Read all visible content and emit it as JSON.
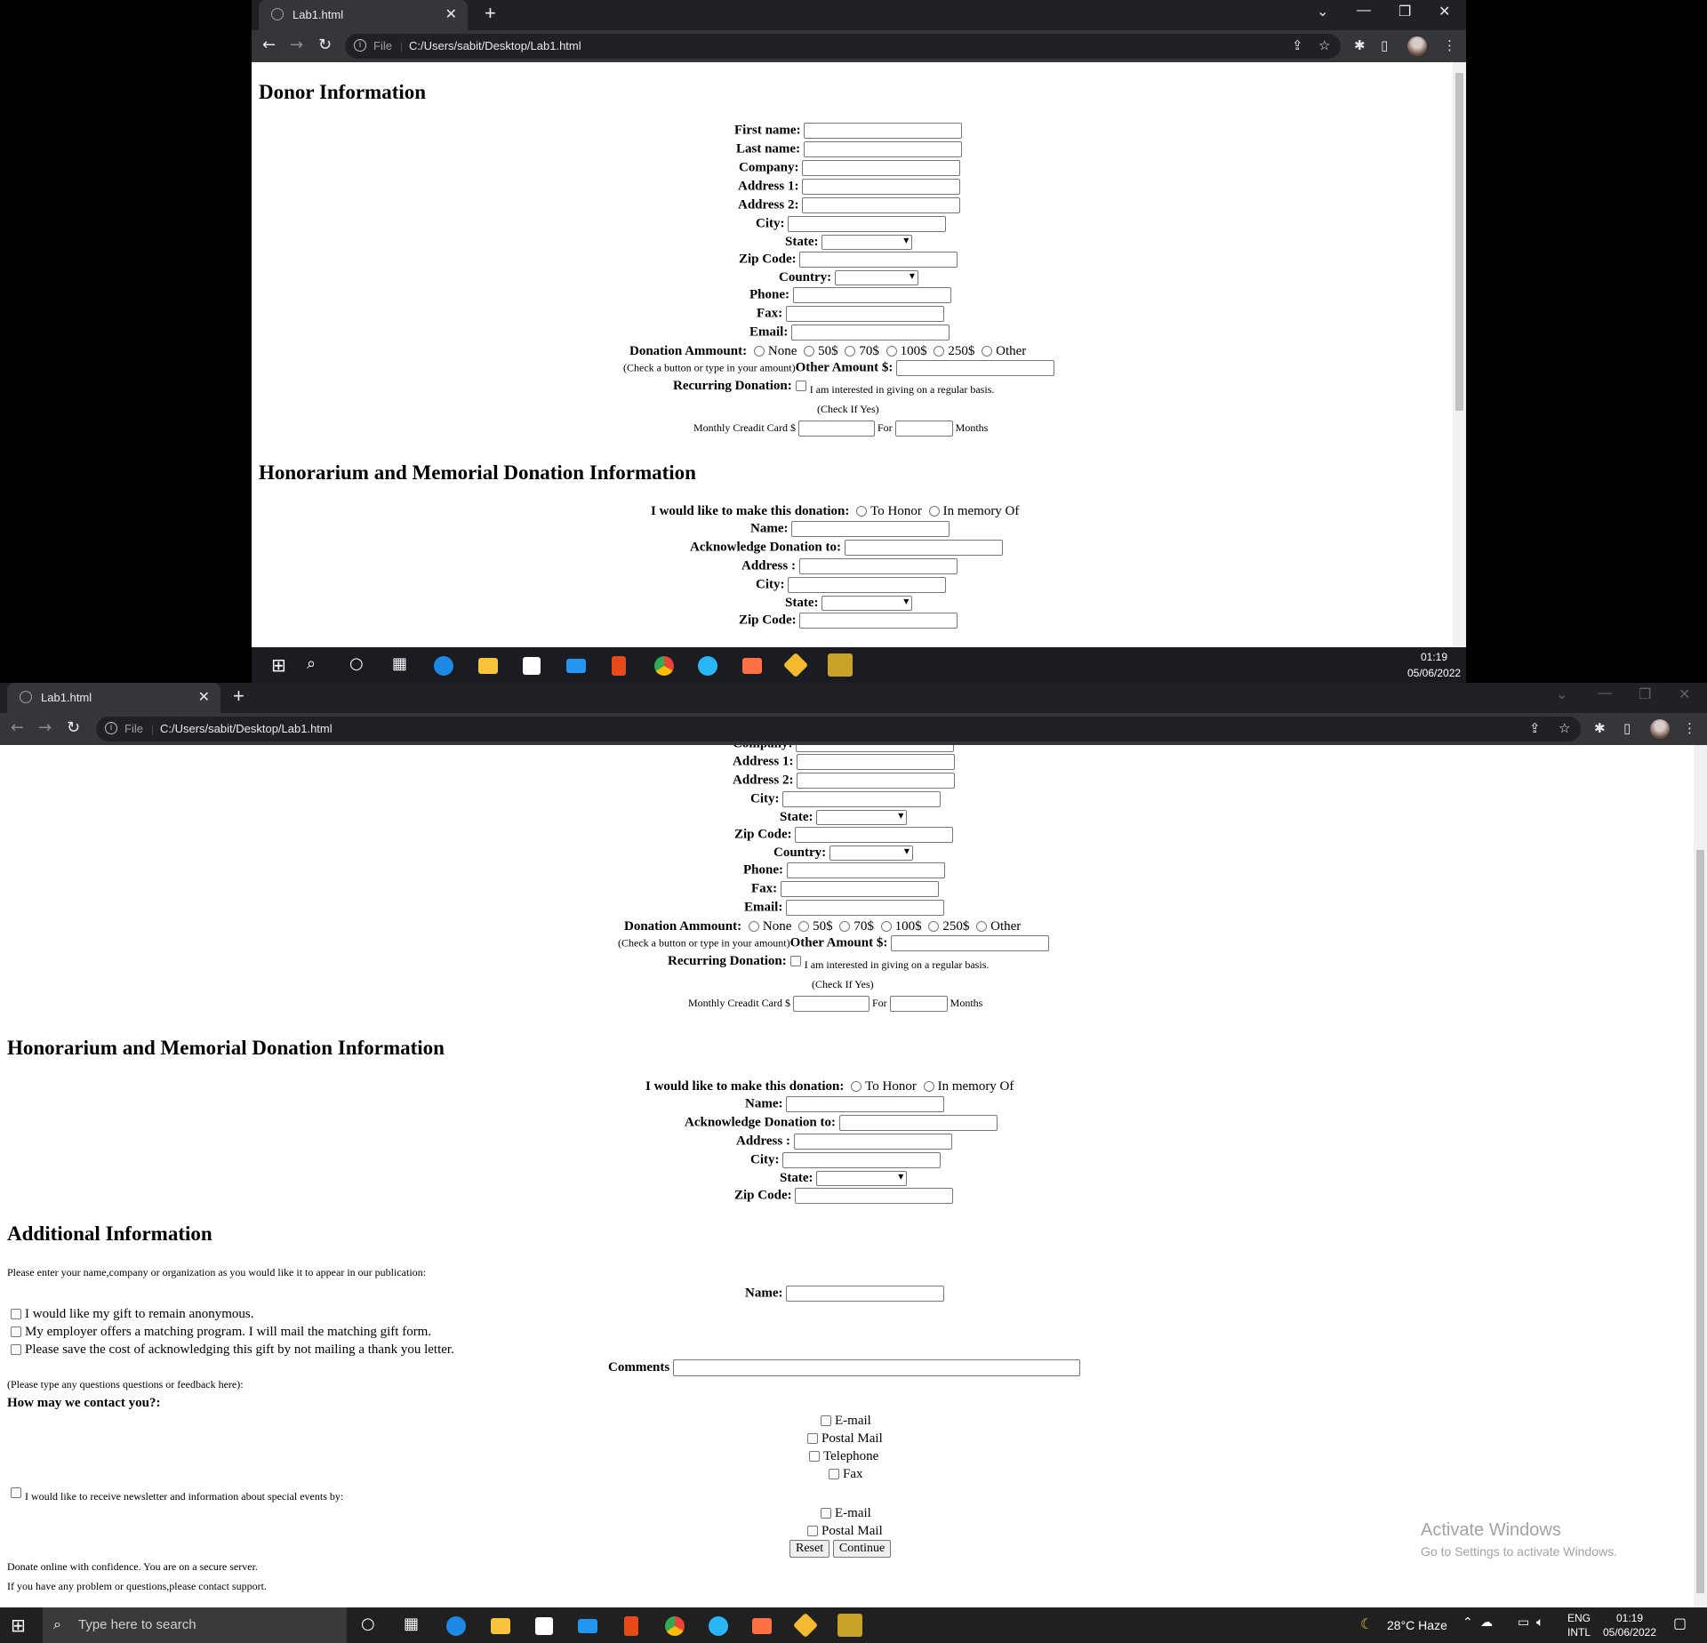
{
  "browser": {
    "tab_title": "Lab1.html",
    "new_tab": "+",
    "file_label": "File",
    "url": "C:/Users/sabit/Desktop/Lab1.html",
    "info_glyph": "i"
  },
  "donor": {
    "heading": "Donor Information",
    "first_name": "First name:",
    "last_name": "Last name:",
    "company": "Company:",
    "address1": "Address 1:",
    "address2": "Address 2:",
    "city": "City:",
    "state": "State:",
    "zip": "Zip Code:",
    "country": "Country:",
    "phone": "Phone:",
    "fax": "Fax:",
    "email": "Email:",
    "donation_amount": "Donation Ammount:",
    "amount_options": [
      "None",
      "50$",
      "70$",
      "100$",
      "250$",
      "Other"
    ],
    "check_hint": "(Check a button or type in your amount)",
    "other_amount": "Other Amount $:",
    "recurring": "Recurring Donation:",
    "recurring_text": "I am interested in giving on a regular basis.",
    "check_if_yes": "(Check If Yes)",
    "monthly": "Monthly Creadit Card $",
    "for": "For",
    "months": "Months"
  },
  "honor": {
    "heading": "Honorarium and Memorial Donation Information",
    "make_donation": "I would like to make this donation:",
    "to_honor": "To Honor",
    "in_memory": "In memory Of",
    "name": "Name:",
    "acknowledge": "Acknowledge Donation to:",
    "address": "Address :",
    "city": "City:",
    "state": "State:",
    "zip": "Zip Code:"
  },
  "additional": {
    "heading": "Additional Information",
    "intro": "Please enter your name,company or organization as you would like it to appear in our publication:",
    "name": "Name:",
    "anonymous": "I would like my gift to remain anonymous.",
    "employer": "My employer offers a matching program. I will mail the matching gift form.",
    "save_cost": "Please save the cost of acknowledging this gift by not mailing a thank you letter.",
    "comments": "Comments",
    "comments_hint": "(Please type any questions questions or feedback here):",
    "contact_q": "How may we contact you?:",
    "contact_options": [
      "E-mail",
      "Postal Mail",
      "Telephone",
      "Fax"
    ],
    "newsletter": "I would like to receive newsletter and information about special events by:",
    "newsletter_options": [
      "E-mail",
      "Postal Mail"
    ],
    "reset": "Reset",
    "continue": "Continue",
    "secure": "Donate online with confidence. You are on a secure server.",
    "support": "If you have any problem or questions,please contact support."
  },
  "taskbar": {
    "time": "01:19",
    "date": "05/06/2022",
    "search_placeholder": "Type here to search",
    "weather": "28°C  Haze",
    "lang1": "ENG",
    "lang2": "INTL"
  },
  "watermark": {
    "title": "Activate Windows",
    "subtitle": "Go to Settings to activate Windows."
  },
  "colors": {
    "chrome_dark": "#202124",
    "chrome_toolbar": "#35363a",
    "taskbar": "#1a1c22",
    "page_bg": "#ffffff"
  }
}
